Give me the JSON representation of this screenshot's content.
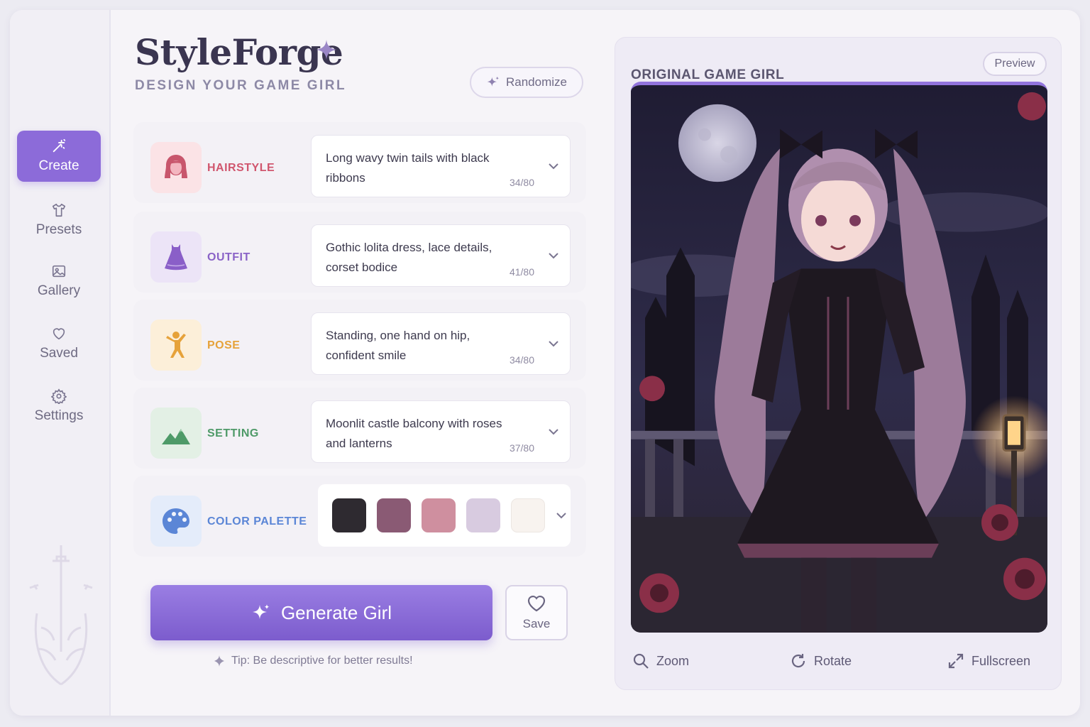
{
  "app": {
    "title": "StyleForge",
    "subtitle": "DESIGN YOUR GAME GIRL",
    "randomize_label": "Randomize"
  },
  "sidebar": {
    "items": [
      {
        "label": "Create",
        "icon": "magic-wand-icon",
        "active": true
      },
      {
        "label": "Presets",
        "icon": "shirt-icon",
        "active": false
      },
      {
        "label": "Gallery",
        "icon": "image-icon",
        "active": false
      },
      {
        "label": "Saved",
        "icon": "heart-icon",
        "active": false
      },
      {
        "label": "Settings",
        "icon": "gear-icon",
        "active": false
      }
    ]
  },
  "fields": [
    {
      "label": "HAIRSTYLE",
      "value": "Long wavy twin tails with black ribbons",
      "count": "34/80",
      "color": "#d0566e",
      "icon": "hairstyle-icon"
    },
    {
      "label": "OUTFIT",
      "value": "Gothic lolita dress, lace details, corset bodice",
      "count": "41/80",
      "color": "#8a63c7",
      "icon": "dress-icon"
    },
    {
      "label": "POSE",
      "value": "Standing, one hand on hip, confident smile",
      "count": "34/80",
      "color": "#e6a23a",
      "icon": "pose-icon"
    },
    {
      "label": "SETTING",
      "value": "Moonlit castle balcony with roses and lanterns",
      "count": "37/80",
      "color": "#4e9a68",
      "icon": "mountain-icon"
    }
  ],
  "palette": {
    "label": "COLOR PALETTE",
    "color": "#5b86d6",
    "icon": "palette-icon",
    "swatches": [
      "#2e2a30",
      "#8a5a74",
      "#cf8f9f",
      "#d8cbe0",
      "#f8f3ef"
    ]
  },
  "actions": {
    "generate_label": "Generate Girl",
    "save_label": "Save",
    "tip": "Tip: Be descriptive for better results!"
  },
  "preview": {
    "title": "ORIGINAL GAME GIRL",
    "pill_label": "Preview",
    "zoom_label": "Zoom",
    "rotate_label": "Rotate",
    "fullscreen_label": "Fullscreen"
  }
}
